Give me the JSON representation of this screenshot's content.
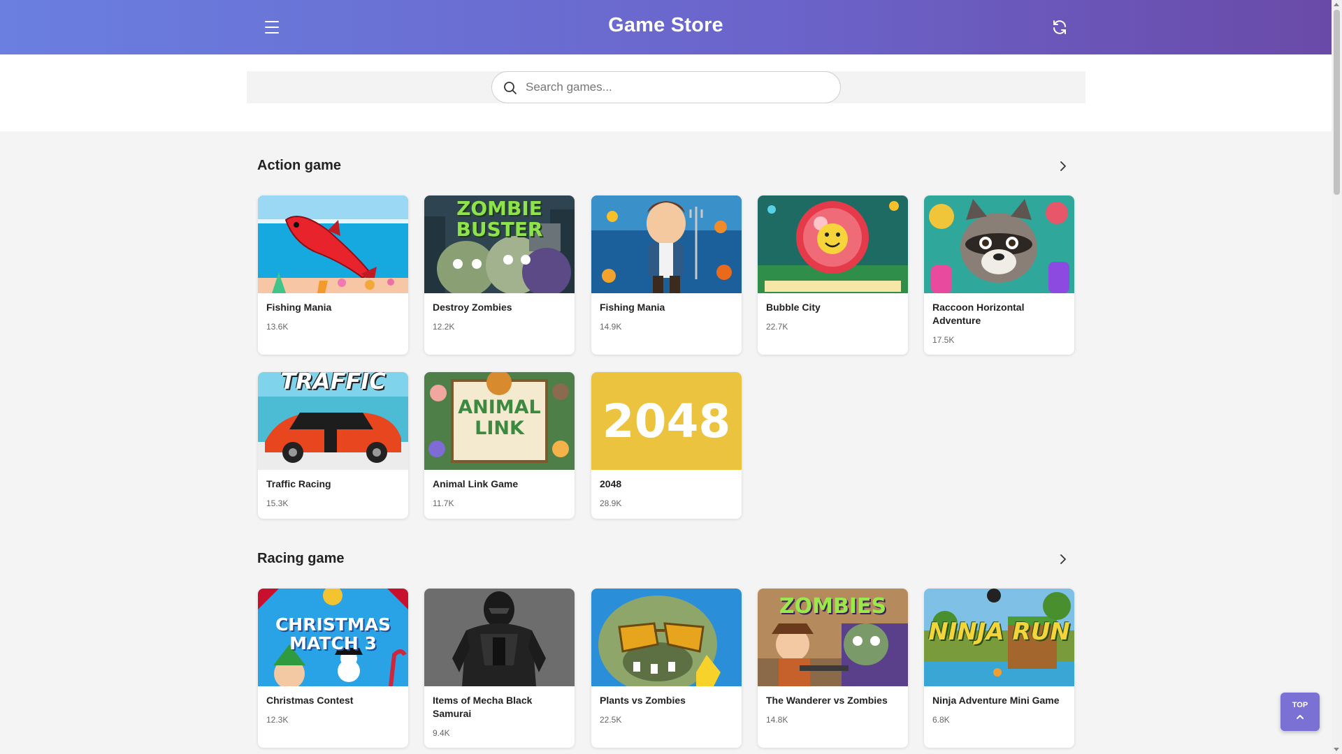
{
  "header": {
    "title": "Game Store",
    "menu_icon": "hamburger-menu-icon",
    "refresh_icon": "refresh-icon"
  },
  "search": {
    "placeholder": "Search games...",
    "value": ""
  },
  "sections": [
    {
      "title": "Action game",
      "games": [
        {
          "name": "Fishing Mania",
          "plays": "13.6K"
        },
        {
          "name": "Destroy Zombies",
          "plays": "12.2K"
        },
        {
          "name": "Fishing Mania",
          "plays": "14.9K"
        },
        {
          "name": "Bubble City",
          "plays": "22.7K"
        },
        {
          "name": "Raccoon Horizontal Adventure",
          "plays": "17.5K"
        },
        {
          "name": "Traffic Racing",
          "plays": "15.3K"
        },
        {
          "name": "Animal Link Game",
          "plays": "11.7K"
        },
        {
          "name": "2048",
          "plays": "28.9K"
        }
      ]
    },
    {
      "title": "Racing game",
      "games": [
        {
          "name": "Christmas Contest",
          "plays": "12.3K"
        },
        {
          "name": "Items of Mecha Black Samurai",
          "plays": "9.4K"
        },
        {
          "name": "Plants vs Zombies",
          "plays": "22.5K"
        },
        {
          "name": "The Wanderer vs Zombies",
          "plays": "14.8K"
        },
        {
          "name": "Ninja Adventure Mini Game",
          "plays": "6.8K"
        }
      ]
    }
  ],
  "thumb_text": {
    "zombie_buster": "ZOMBIE BUSTER",
    "traffic": "TRAFFIC",
    "animal_link": "ANIMAL LINK",
    "t2048": "2048",
    "christmas_match": "CHRISTMAS MATCH 3",
    "zombies": "ZOMBIES",
    "ninja_run": "NINJA RUN"
  },
  "top_button": {
    "label": "TOP"
  },
  "colors": {
    "header_start": "#6a7fe0",
    "header_end": "#6a4aa8",
    "top_button": "#7b70d4",
    "tile_2048": "#ecc33f"
  }
}
